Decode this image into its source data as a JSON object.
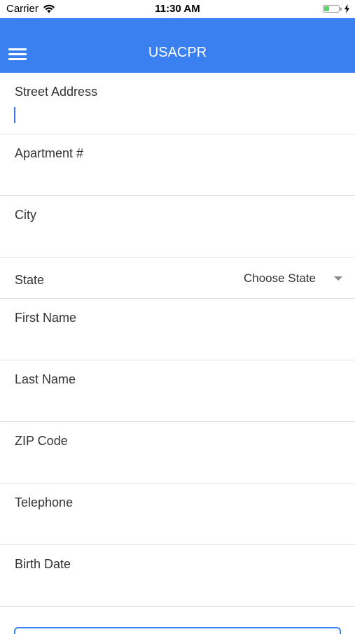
{
  "status_bar": {
    "carrier": "Carrier",
    "time": "11:30 AM",
    "icons": [
      "wifi-icon",
      "battery-icon",
      "charging-icon"
    ],
    "battery_level": 0.35
  },
  "nav": {
    "title": "USACPR",
    "menu_icon": "hamburger-menu-icon",
    "color": "#3b80f0"
  },
  "form": {
    "street_address": {
      "label": "Street Address",
      "value": ""
    },
    "apartment": {
      "label": "Apartment #",
      "value": ""
    },
    "city": {
      "label": "City",
      "value": ""
    },
    "state": {
      "label": "State",
      "selected": "Choose State"
    },
    "first_name": {
      "label": "First Name",
      "value": ""
    },
    "last_name": {
      "label": "Last Name",
      "value": ""
    },
    "zip": {
      "label": "ZIP Code",
      "value": ""
    },
    "telephone": {
      "label": "Telephone",
      "value": ""
    },
    "birth_date": {
      "label": "Birth Date",
      "value": ""
    }
  }
}
